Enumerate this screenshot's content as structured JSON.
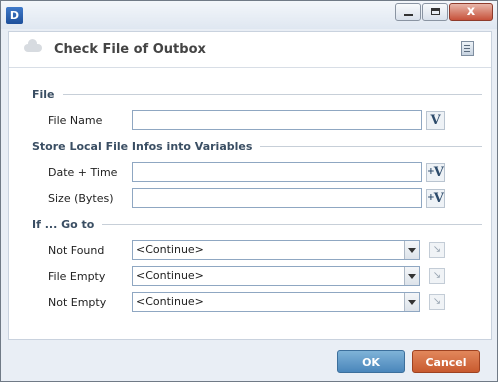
{
  "window": {
    "app_icon_text": "D",
    "min_symbol": "",
    "max_symbol": "",
    "close_symbol": "x"
  },
  "dialog": {
    "title": "Check File of Outbox"
  },
  "sections": {
    "file": "File",
    "store": "Store Local File Infos into Variables",
    "goto": "If ... Go to"
  },
  "fields": {
    "file_name": {
      "label": "File Name",
      "value": ""
    },
    "date_time": {
      "label": "Date + Time",
      "value": ""
    },
    "size_bytes": {
      "label": "Size (Bytes)",
      "value": ""
    }
  },
  "variable_button": {
    "symbol": "V",
    "add_symbol": "+"
  },
  "goto": {
    "not_found": {
      "label": "Not Found",
      "value": "<Continue>"
    },
    "file_empty": {
      "label": "File Empty",
      "value": "<Continue>"
    },
    "not_empty": {
      "label": "Not Empty",
      "value": "<Continue>"
    },
    "jump_symbol": "↘"
  },
  "buttons": {
    "ok": "OK",
    "cancel": "Cancel"
  },
  "colors": {
    "ok": "#4a86bb",
    "cancel": "#c85a2f",
    "section_text": "#3a4e63"
  }
}
